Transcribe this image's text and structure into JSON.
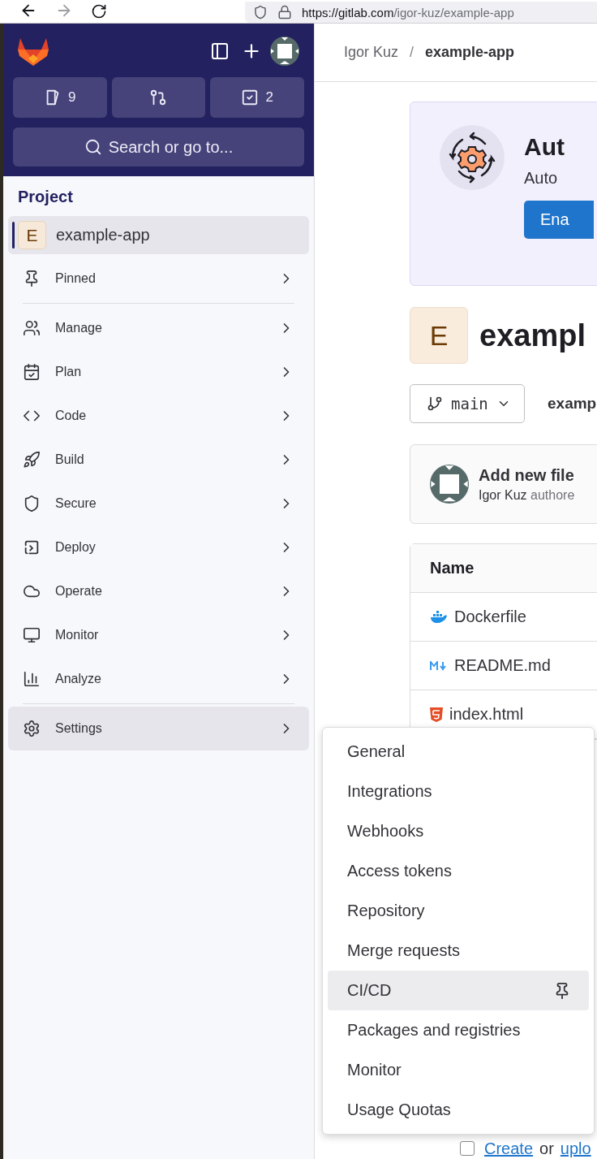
{
  "browser": {
    "url_host": "https://gitlab.com",
    "url_path": "/igor-kuz/example-app"
  },
  "sidebar": {
    "counts": [
      {
        "kind": "issues",
        "count": "9"
      },
      {
        "kind": "merge_requests"
      },
      {
        "kind": "todos",
        "count": "2"
      }
    ],
    "search": {
      "placeholder": "Search or go to..."
    },
    "section_title": "Project",
    "project": {
      "initial": "E",
      "name": "example-app",
      "selected": true
    },
    "groups": [
      [
        {
          "kind": "pin",
          "label": "Pinned",
          "selected": false
        }
      ],
      [
        {
          "kind": "users",
          "label": "Manage",
          "selected": false
        },
        {
          "kind": "calendar",
          "label": "Plan",
          "selected": false
        },
        {
          "kind": "code",
          "label": "Code",
          "selected": false
        },
        {
          "kind": "rocket",
          "label": "Build",
          "selected": false
        },
        {
          "kind": "shield",
          "label": "Secure",
          "selected": false
        },
        {
          "kind": "deploy",
          "label": "Deploy",
          "selected": false
        },
        {
          "kind": "cloud",
          "label": "Operate",
          "selected": false
        },
        {
          "kind": "monitor",
          "label": "Monitor",
          "selected": false
        },
        {
          "kind": "chart",
          "label": "Analyze",
          "selected": false
        }
      ],
      [
        {
          "kind": "settings",
          "label": "Settings",
          "selected": true
        }
      ]
    ]
  },
  "breadcrumb": {
    "items": [
      "Igor Kuz",
      "example-app"
    ],
    "separator": "/"
  },
  "banner": {
    "title": "Aut",
    "text": "Auto",
    "button": "Ena"
  },
  "project": {
    "initial": "E",
    "name": "exampl"
  },
  "branch": {
    "name": "main",
    "path": "examp"
  },
  "commit": {
    "title": "Add new file",
    "author": "Igor Kuz",
    "text": "authore"
  },
  "files": {
    "header": "Name",
    "rows": [
      {
        "kind": "docker",
        "name": "Dockerfile"
      },
      {
        "kind": "markdown",
        "name": "README.md"
      },
      {
        "kind": "html",
        "name": "index.html"
      }
    ]
  },
  "footer": {
    "checked": false,
    "link": "Create",
    "text": "or",
    "link2": "uplo"
  },
  "menu": {
    "items": [
      {
        "label": "General",
        "selected": false
      },
      {
        "label": "Integrations",
        "selected": false
      },
      {
        "label": "Webhooks",
        "selected": false
      },
      {
        "label": "Access tokens",
        "selected": false
      },
      {
        "label": "Repository",
        "selected": false
      },
      {
        "label": "Merge requests",
        "selected": false
      },
      {
        "label": "CI/CD",
        "selected": true
      },
      {
        "label": "Packages and registries",
        "selected": false
      },
      {
        "label": "Monitor",
        "selected": false
      },
      {
        "label": "Usage Quotas",
        "selected": false
      }
    ]
  }
}
